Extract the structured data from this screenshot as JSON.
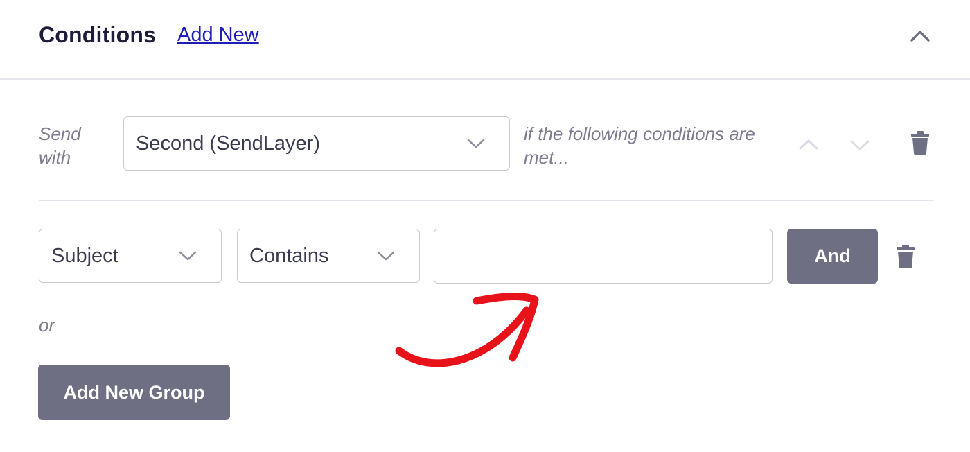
{
  "header": {
    "title": "Conditions",
    "add_new_label": "Add New",
    "collapse_icon": "chevron-up-icon"
  },
  "rule": {
    "send_label": "Send with",
    "provider_selected": "Second (SendLayer)",
    "conditions_text": "if the following conditions are met...",
    "move_up_icon": "chevron-up-icon",
    "move_down_icon": "chevron-down-icon",
    "delete_icon": "trash-icon"
  },
  "condition": {
    "field_selected": "Subject",
    "operator_selected": "Contains",
    "value": "",
    "and_label": "And",
    "delete_icon": "trash-icon"
  },
  "or_label": "or",
  "add_group_label": "Add New Group",
  "colors": {
    "button_bg": "#6f6f84",
    "link": "#1f1fb8",
    "annotation_arrow": "#e8121b",
    "title": "#1d1d3a"
  }
}
